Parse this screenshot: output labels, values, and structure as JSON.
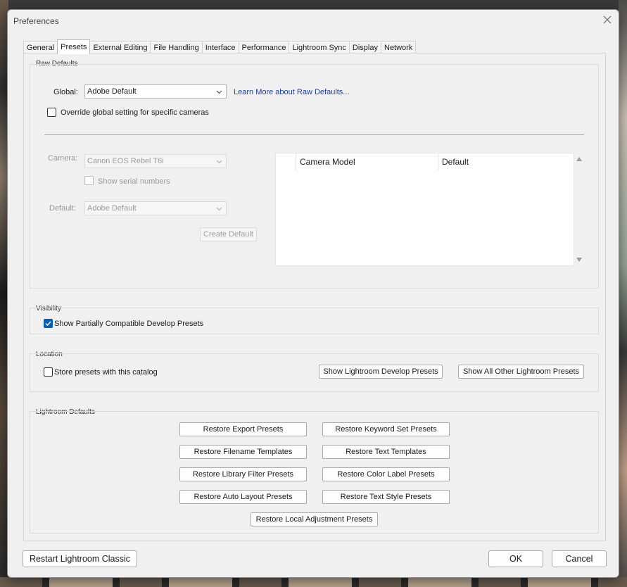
{
  "window": {
    "title": "Preferences"
  },
  "tabs": [
    {
      "label": "General"
    },
    {
      "label": "Presets",
      "active": true
    },
    {
      "label": "External Editing"
    },
    {
      "label": "File Handling"
    },
    {
      "label": "Interface"
    },
    {
      "label": "Performance"
    },
    {
      "label": "Lightroom Sync"
    },
    {
      "label": "Display"
    },
    {
      "label": "Network"
    }
  ],
  "raw_defaults": {
    "group_label": "Raw Defaults",
    "global_label": "Global:",
    "global_value": "Adobe Default",
    "learn_more_link": "Learn More about Raw Defaults...",
    "override_checkbox": "Override global setting for specific cameras",
    "override_checked": false,
    "camera_label": "Camera:",
    "camera_value": "Canon EOS Rebel T6i",
    "show_serial_label": "Show serial numbers",
    "default_label": "Default:",
    "default_value": "Adobe Default",
    "create_default_button": "Create Default",
    "table_columns": [
      "",
      "Camera Model",
      "Default"
    ]
  },
  "visibility": {
    "group_label": "Visibility",
    "show_partial_label": "Show Partially Compatible Develop Presets",
    "show_partial_checked": true
  },
  "location": {
    "group_label": "Location",
    "store_with_catalog_label": "Store presets with this catalog",
    "store_with_catalog_checked": false,
    "show_develop_button": "Show Lightroom Develop Presets",
    "show_other_button": "Show All Other Lightroom Presets"
  },
  "lightroom_defaults": {
    "group_label": "Lightroom Defaults",
    "buttons": [
      "Restore Export Presets",
      "Restore Keyword Set Presets",
      "Restore Filename Templates",
      "Restore Text Templates",
      "Restore Library Filter Presets",
      "Restore Color Label Presets",
      "Restore Auto Layout Presets",
      "Restore Text Style Presets",
      "Restore Local Adjustment Presets"
    ]
  },
  "footer": {
    "restart_button": "Restart Lightroom Classic",
    "ok_button": "OK",
    "cancel_button": "Cancel"
  },
  "colors": {
    "accent": "#005fb8",
    "link": "#1a3fa8",
    "dialog_bg": "#f0f0f0"
  }
}
